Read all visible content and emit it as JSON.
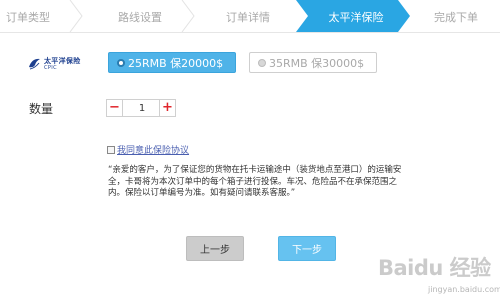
{
  "steps": [
    {
      "label": "订单类型",
      "active": false
    },
    {
      "label": "路线设置",
      "active": false
    },
    {
      "label": "订单详情",
      "active": false
    },
    {
      "label": "太平洋保险",
      "active": true
    },
    {
      "label": "完成下单",
      "active": false
    }
  ],
  "colors": {
    "accent": "#4fb3e8",
    "active_step": "#2aa6e3",
    "next_button": "#66c2f0",
    "qty_buttons": "#e0252b",
    "link": "#4a5fb0"
  },
  "insurer": {
    "logo_cn": "太平洋保险",
    "logo_en": "CPIC"
  },
  "insurance_options": [
    {
      "label": "25RMB 保20000$",
      "selected": true
    },
    {
      "label": "35RMB 保30000$",
      "selected": false
    }
  ],
  "quantity": {
    "label": "数量",
    "minus": "−",
    "value": "1",
    "plus": "+"
  },
  "agreement": {
    "checked": false,
    "link_text": "我同意此保险协议"
  },
  "notice": "“亲爱的客户，为了保证您的货物在托卡运输途中（装货地点至港口）的运输安全，卡哥将为本次订单中的每个箱子进行投保。车况、危险品不在承保范围之内。保险以订单编号为准。如有疑问请联系客服。”",
  "buttons": {
    "prev": "上一步",
    "next": "下一步"
  },
  "watermark": {
    "main": "Baidu 经验",
    "sub": "jingyan.baidu.com"
  }
}
